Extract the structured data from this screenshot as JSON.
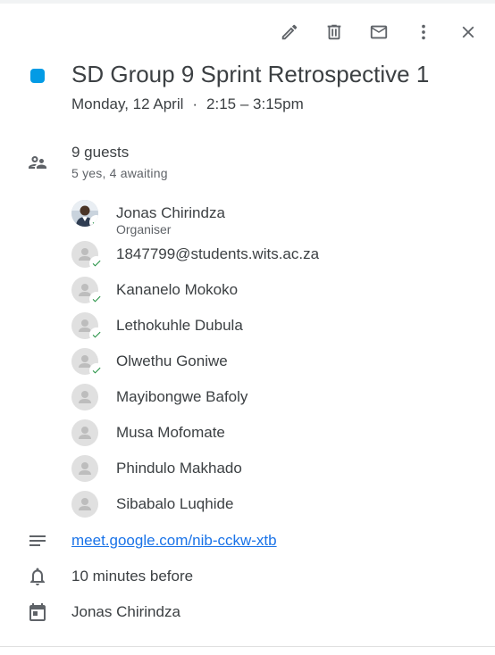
{
  "toolbar": {
    "edit_icon": "pencil-icon",
    "delete_icon": "trash-icon",
    "email_icon": "envelope-icon",
    "more_icon": "more-vert-icon",
    "close_icon": "close-icon"
  },
  "event": {
    "title": "SD Group 9 Sprint Retrospective 1",
    "date": "Monday, 12 April",
    "separator": "·",
    "time": "2:15 – 3:15pm",
    "calendar_color": "#039be5"
  },
  "guests": {
    "count_label": "9 guests",
    "summary": "5 yes, 4 awaiting",
    "list": [
      {
        "name": "Jonas Chirindza",
        "role": "Organiser",
        "accepted": true,
        "photo": true
      },
      {
        "name": "1847799@students.wits.ac.za",
        "accepted": true
      },
      {
        "name": "Kananelo Mokoko",
        "accepted": true
      },
      {
        "name": "Lethokuhle Dubula",
        "accepted": true
      },
      {
        "name": "Olwethu Goniwe",
        "accepted": true
      },
      {
        "name": "Mayibongwe Bafoly",
        "accepted": false
      },
      {
        "name": "Musa Mofomate",
        "accepted": false
      },
      {
        "name": "Phindulo Makhado",
        "accepted": false
      },
      {
        "name": "Sibabalo Luqhide",
        "accepted": false
      }
    ]
  },
  "description": {
    "link": "meet.google.com/nib-cckw-xtb"
  },
  "reminder": {
    "text": "10 minutes before"
  },
  "calendar": {
    "owner": "Jonas Chirindza"
  },
  "colors": {
    "accepted_check": "#1e8e3e",
    "link": "#1a73e8",
    "icon": "#5f6368"
  }
}
